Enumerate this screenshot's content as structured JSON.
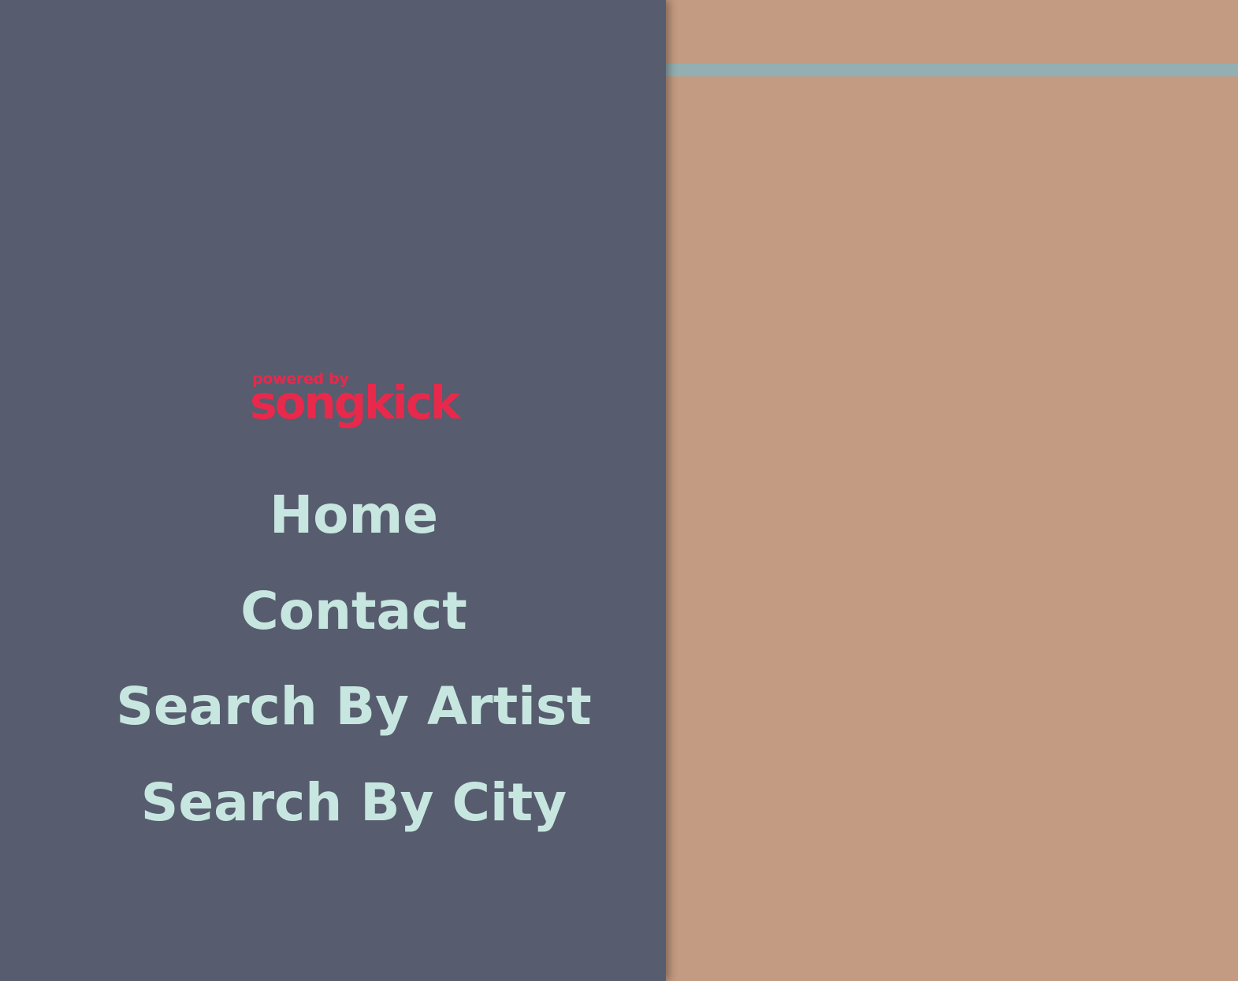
{
  "colors": {
    "sidebar_bg": "#575c6f",
    "main_bg": "#c39a82",
    "stripe": "#94afb1",
    "nav_text": "#c7e6e0",
    "logo": "#e8294b"
  },
  "logo": {
    "powered_by": "powered by",
    "brand": "songkick"
  },
  "nav": {
    "items": [
      {
        "label": "Home"
      },
      {
        "label": "Contact"
      },
      {
        "label": "Search By Artist"
      },
      {
        "label": "Search By City"
      }
    ]
  }
}
